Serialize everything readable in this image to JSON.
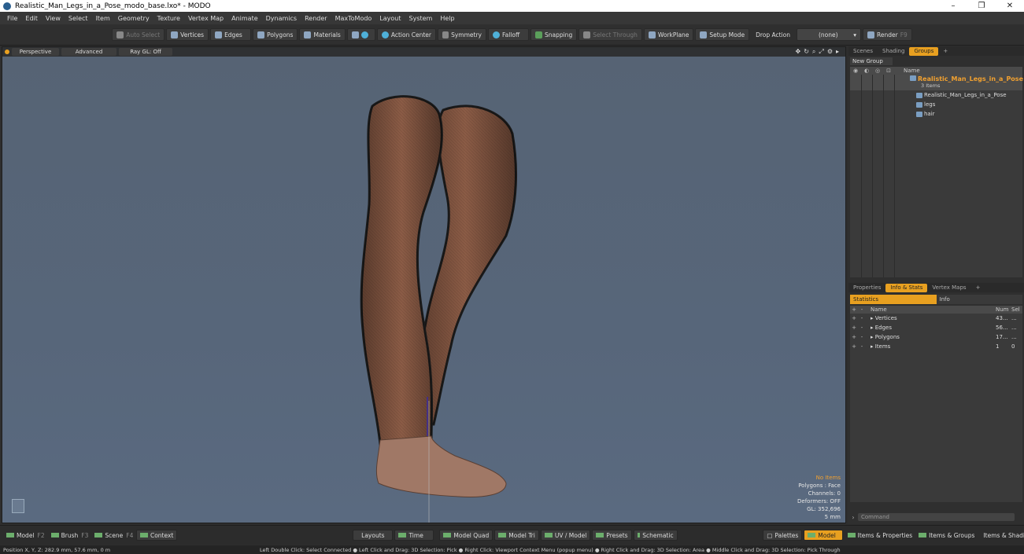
{
  "window": {
    "title": "Realistic_Man_Legs_in_a_Pose_modo_base.lxo* - MODO",
    "minimize": "–",
    "maximize": "❐",
    "close": "✕"
  },
  "menu": [
    "File",
    "Edit",
    "View",
    "Select",
    "Item",
    "Geometry",
    "Texture",
    "Vertex Map",
    "Animate",
    "Dynamics",
    "Render",
    "MaxToModo",
    "Layout",
    "System",
    "Help"
  ],
  "toolbar": {
    "auto_select": "Auto Select",
    "vertices": "Vertices",
    "edges": "Edges",
    "polygons": "Polygons",
    "materials": "Materials",
    "action_center": "Action Center",
    "symmetry": "Symmetry",
    "falloff": "Falloff",
    "snapping": "Snapping",
    "select_through": "Select Through",
    "workplane": "WorkPlane",
    "setup_mode": "Setup Mode",
    "drop_action": "Drop Action",
    "drop_value": "(none)",
    "render": "Render",
    "render_key": "F9"
  },
  "viewport": {
    "perspective": "Perspective",
    "advanced": "Advanced",
    "raygl": "Ray GL: Off",
    "info": {
      "items": "No Items",
      "polygons": "Polygons : Face",
      "channels": "Channels: 0",
      "deformers": "Deformers: OFF",
      "gl": "GL: 352,696",
      "scale": "5 mm"
    }
  },
  "groups_panel": {
    "tabs": [
      "Scenes",
      "Shading",
      "Groups"
    ],
    "active_tab": "Groups",
    "new_group": "New Group",
    "name_col": "Name",
    "root_name": "Realistic_Man_Legs_in_a_Pose",
    "root_count": "3 Items",
    "children": [
      "Realistic_Man_Legs_in_a_Pose",
      "legs",
      "hair"
    ]
  },
  "stats_panel": {
    "tabs": [
      "Properties",
      "Info & Stats",
      "Vertex Maps"
    ],
    "active_tab": "Info & Stats",
    "sub_tabs": [
      "Statistics",
      "Info"
    ],
    "col_name": "Name",
    "col_num": "Num",
    "col_sel": "Sel",
    "rows": [
      {
        "name": "Vertices",
        "num": "43...",
        "sel": "..."
      },
      {
        "name": "Edges",
        "num": "56...",
        "sel": "..."
      },
      {
        "name": "Polygons",
        "num": "17...",
        "sel": "..."
      },
      {
        "name": "Items",
        "num": "1",
        "sel": "0"
      }
    ]
  },
  "command": {
    "placeholder": "Command"
  },
  "bottom": {
    "model": "Model",
    "model_key": "F2",
    "brush": "Brush",
    "brush_key": "F3",
    "scene": "Scene",
    "scene_key": "F4",
    "context": "Context",
    "layouts": "Layouts",
    "time": "Time",
    "model_quad": "Model Quad",
    "model_tri": "Model Tri",
    "uv_model": "UV / Model",
    "presets": "Presets",
    "schematic": "Schematic",
    "palettes": "Palettes",
    "model_active": "Model",
    "items_properties": "Items & Properties",
    "items_groups": "Items & Groups",
    "items_shading": "Items & Shading"
  },
  "status": {
    "position": "Position X, Y, Z:  282.9 mm, 57.6 mm, 0 m",
    "hint": "Left Double Click: Select Connected ● Left Click and Drag: 3D Selection: Pick ● Right Click: Viewport Context Menu (popup menu) ● Right Click and Drag: 3D Selection: Area ● Middle Click and Drag: 3D Selection: Pick Through"
  },
  "colors": {
    "accent": "#e8a020",
    "viewport_bg": "#57667a",
    "skin": "#8a5a44"
  }
}
